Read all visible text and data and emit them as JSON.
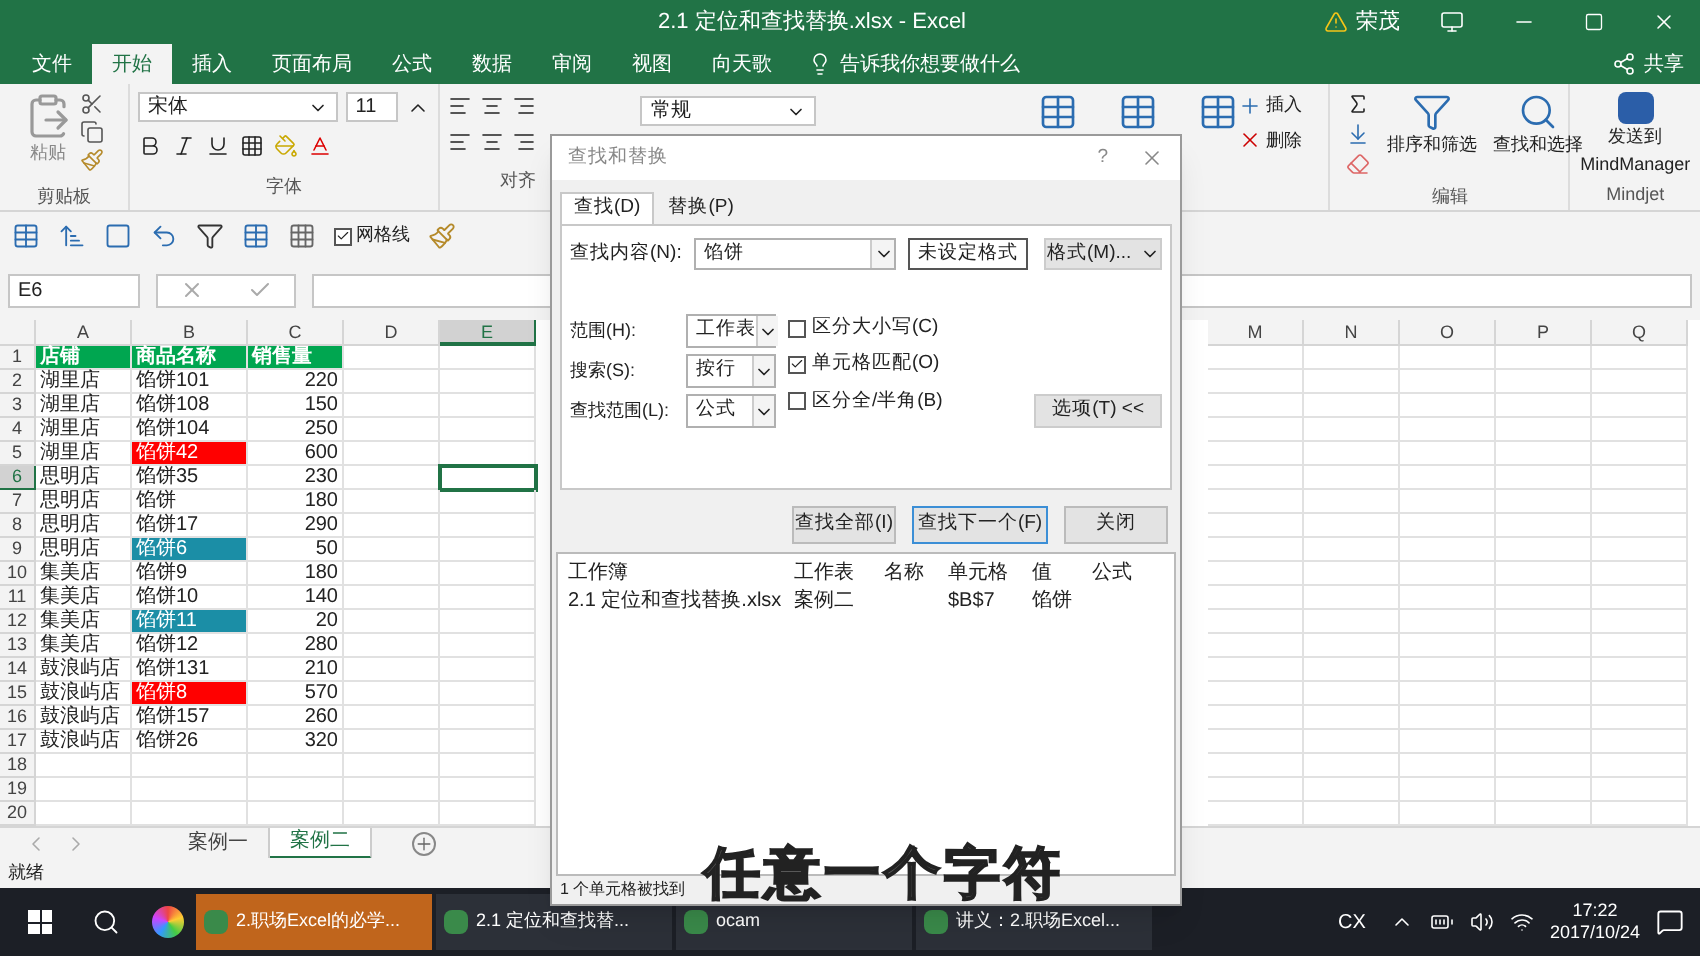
{
  "window": {
    "title": "2.1 定位和查找替换.xlsx - Excel",
    "user": "荣茂"
  },
  "ribbon_tabs": [
    {
      "label": "文件",
      "selected": false
    },
    {
      "label": "开始",
      "selected": true
    },
    {
      "label": "插入",
      "selected": false
    },
    {
      "label": "页面布局",
      "selected": false
    },
    {
      "label": "公式",
      "selected": false
    },
    {
      "label": "数据",
      "selected": false
    },
    {
      "label": "审阅",
      "selected": false
    },
    {
      "label": "视图",
      "selected": false
    },
    {
      "label": "向天歌",
      "selected": false
    }
  ],
  "tell_me": "告诉我你想要做什么",
  "share": "共享",
  "ribbon": {
    "paste": "粘贴",
    "font": "宋体",
    "font_size": "11",
    "number_format": "常规",
    "insert": "插入",
    "delete": "删除",
    "sort_filter": "排序和筛选",
    "find_select": "查找和选择",
    "send_to": "发送到",
    "mindmanager": "MindManager",
    "clipboard_group": "剪贴板",
    "font_group": "字体",
    "align_group": "对齐",
    "edit_group": "编辑",
    "mindjet_group": "Mindjet"
  },
  "quick_toolbar": {
    "gridlines_label": "网格线",
    "gridlines_checked": true
  },
  "name_box": "E6",
  "sheet": {
    "columns_left": [
      {
        "label": "A",
        "selected": false
      },
      {
        "label": "B",
        "selected": false
      },
      {
        "label": "C",
        "selected": false
      },
      {
        "label": "D",
        "selected": false
      },
      {
        "label": "E",
        "selected": true
      }
    ],
    "columns_right": [
      {
        "label": "M",
        "selected": false
      },
      {
        "label": "N",
        "selected": false
      },
      {
        "label": "O",
        "selected": false
      },
      {
        "label": "P",
        "selected": false
      },
      {
        "label": "Q",
        "selected": false
      }
    ],
    "rows": [
      {
        "number": "1",
        "selected": false,
        "cells": [
          {
            "text": "店铺",
            "kind": "header"
          },
          {
            "text": "商品名称",
            "kind": "header"
          },
          {
            "text": "销售量",
            "kind": "header"
          }
        ]
      },
      {
        "number": "2",
        "selected": false,
        "cells": [
          {
            "text": "湖里店",
            "kind": "text"
          },
          {
            "text": "馅饼101",
            "kind": "text"
          },
          {
            "text": "220",
            "kind": "number"
          }
        ]
      },
      {
        "number": "3",
        "selected": false,
        "cells": [
          {
            "text": "湖里店",
            "kind": "text"
          },
          {
            "text": "馅饼108",
            "kind": "text"
          },
          {
            "text": "150",
            "kind": "number"
          }
        ]
      },
      {
        "number": "4",
        "selected": false,
        "cells": [
          {
            "text": "湖里店",
            "kind": "text"
          },
          {
            "text": "馅饼104",
            "kind": "text"
          },
          {
            "text": "250",
            "kind": "number"
          }
        ]
      },
      {
        "number": "5",
        "selected": false,
        "cells": [
          {
            "text": "湖里店",
            "kind": "text"
          },
          {
            "text": "馅饼42",
            "kind": "text",
            "color": "#ff0000"
          },
          {
            "text": "600",
            "kind": "number"
          }
        ]
      },
      {
        "number": "6",
        "selected": true,
        "cells": [
          {
            "text": "思明店",
            "kind": "text"
          },
          {
            "text": "馅饼35",
            "kind": "text"
          },
          {
            "text": "230",
            "kind": "number"
          }
        ]
      },
      {
        "number": "7",
        "selected": false,
        "cells": [
          {
            "text": "思明店",
            "kind": "text"
          },
          {
            "text": "馅饼",
            "kind": "text"
          },
          {
            "text": "180",
            "kind": "number"
          }
        ]
      },
      {
        "number": "8",
        "selected": false,
        "cells": [
          {
            "text": "思明店",
            "kind": "text"
          },
          {
            "text": "馅饼17",
            "kind": "text"
          },
          {
            "text": "290",
            "kind": "number"
          }
        ]
      },
      {
        "number": "9",
        "selected": false,
        "cells": [
          {
            "text": "思明店",
            "kind": "text"
          },
          {
            "text": "馅饼6",
            "kind": "text",
            "color": "#1b8ea6"
          },
          {
            "text": "50",
            "kind": "number"
          }
        ]
      },
      {
        "number": "10",
        "selected": false,
        "cells": [
          {
            "text": "集美店",
            "kind": "text"
          },
          {
            "text": "馅饼9",
            "kind": "text"
          },
          {
            "text": "180",
            "kind": "number"
          }
        ]
      },
      {
        "number": "11",
        "selected": false,
        "cells": [
          {
            "text": "集美店",
            "kind": "text"
          },
          {
            "text": "馅饼10",
            "kind": "text"
          },
          {
            "text": "140",
            "kind": "number"
          }
        ]
      },
      {
        "number": "12",
        "selected": false,
        "cells": [
          {
            "text": "集美店",
            "kind": "text"
          },
          {
            "text": "馅饼11",
            "kind": "text",
            "color": "#1b8ea6"
          },
          {
            "text": "20",
            "kind": "number"
          }
        ]
      },
      {
        "number": "13",
        "selected": false,
        "cells": [
          {
            "text": "集美店",
            "kind": "text"
          },
          {
            "text": "馅饼12",
            "kind": "text"
          },
          {
            "text": "280",
            "kind": "number"
          }
        ]
      },
      {
        "number": "14",
        "selected": false,
        "cells": [
          {
            "text": "鼓浪屿店",
            "kind": "text"
          },
          {
            "text": "馅饼131",
            "kind": "text"
          },
          {
            "text": "210",
            "kind": "number"
          }
        ]
      },
      {
        "number": "15",
        "selected": false,
        "cells": [
          {
            "text": "鼓浪屿店",
            "kind": "text"
          },
          {
            "text": "馅饼8",
            "kind": "text",
            "color": "#ff0000"
          },
          {
            "text": "570",
            "kind": "number"
          }
        ]
      },
      {
        "number": "16",
        "selected": false,
        "cells": [
          {
            "text": "鼓浪屿店",
            "kind": "text"
          },
          {
            "text": "馅饼157",
            "kind": "text"
          },
          {
            "text": "260",
            "kind": "number"
          }
        ]
      },
      {
        "number": "17",
        "selected": false,
        "cells": [
          {
            "text": "鼓浪屿店",
            "kind": "text"
          },
          {
            "text": "馅饼26",
            "kind": "text"
          },
          {
            "text": "320",
            "kind": "number"
          }
        ]
      },
      {
        "number": "18",
        "selected": false,
        "cells": []
      },
      {
        "number": "19",
        "selected": false,
        "cells": []
      },
      {
        "number": "20",
        "selected": false,
        "cells": []
      }
    ]
  },
  "sheet_tabs": [
    {
      "label": "案例一",
      "selected": false
    },
    {
      "label": "案例二",
      "selected": true
    }
  ],
  "status": "就绪",
  "dialog": {
    "title": "查找和替换",
    "help": "?",
    "tabs": [
      {
        "label": "查找(D)",
        "selected": true
      },
      {
        "label": "替换(P)",
        "selected": false
      }
    ],
    "find_label": "查找内容(N):",
    "find_value": "馅饼",
    "format_preview": "未设定格式",
    "format_button": "格式(M)...",
    "within_label": "范围(H):",
    "within_value": "工作表",
    "search_label": "搜索(S):",
    "search_value": "按行",
    "look_in_label": "查找范围(L):",
    "look_in_value": "公式",
    "options": [
      {
        "label": "区分大小写(C)",
        "checked": false
      },
      {
        "label": "单元格匹配(O)",
        "checked": true
      },
      {
        "label": "区分全/半角(B)",
        "checked": false
      }
    ],
    "options_button": "选项(T) <<",
    "buttons": [
      "查找全部(I)",
      "查找下一个(F)",
      "关闭"
    ],
    "result_columns": [
      "工作簿",
      "工作表",
      "名称",
      "单元格",
      "值",
      "公式"
    ],
    "results": [
      {
        "workbook": "2.1 定位和查找替换.xlsx",
        "sheet": "案例二",
        "cell": "$B$7",
        "value": "馅饼"
      }
    ],
    "status": "1 个单元格被找到"
  },
  "subtitle": "任意一个字符",
  "taskbar": {
    "items": [
      {
        "label": "2.职场Excel的必学...",
        "highlighted": true
      },
      {
        "label": "2.1 定位和查找替...",
        "highlighted": false
      },
      {
        "label": "ocam",
        "highlighted": false
      },
      {
        "label": "讲义：2.职场Excel...",
        "highlighted": false
      }
    ],
    "tray_text": "CX",
    "time": "17:22",
    "date": "2017/10/24"
  }
}
